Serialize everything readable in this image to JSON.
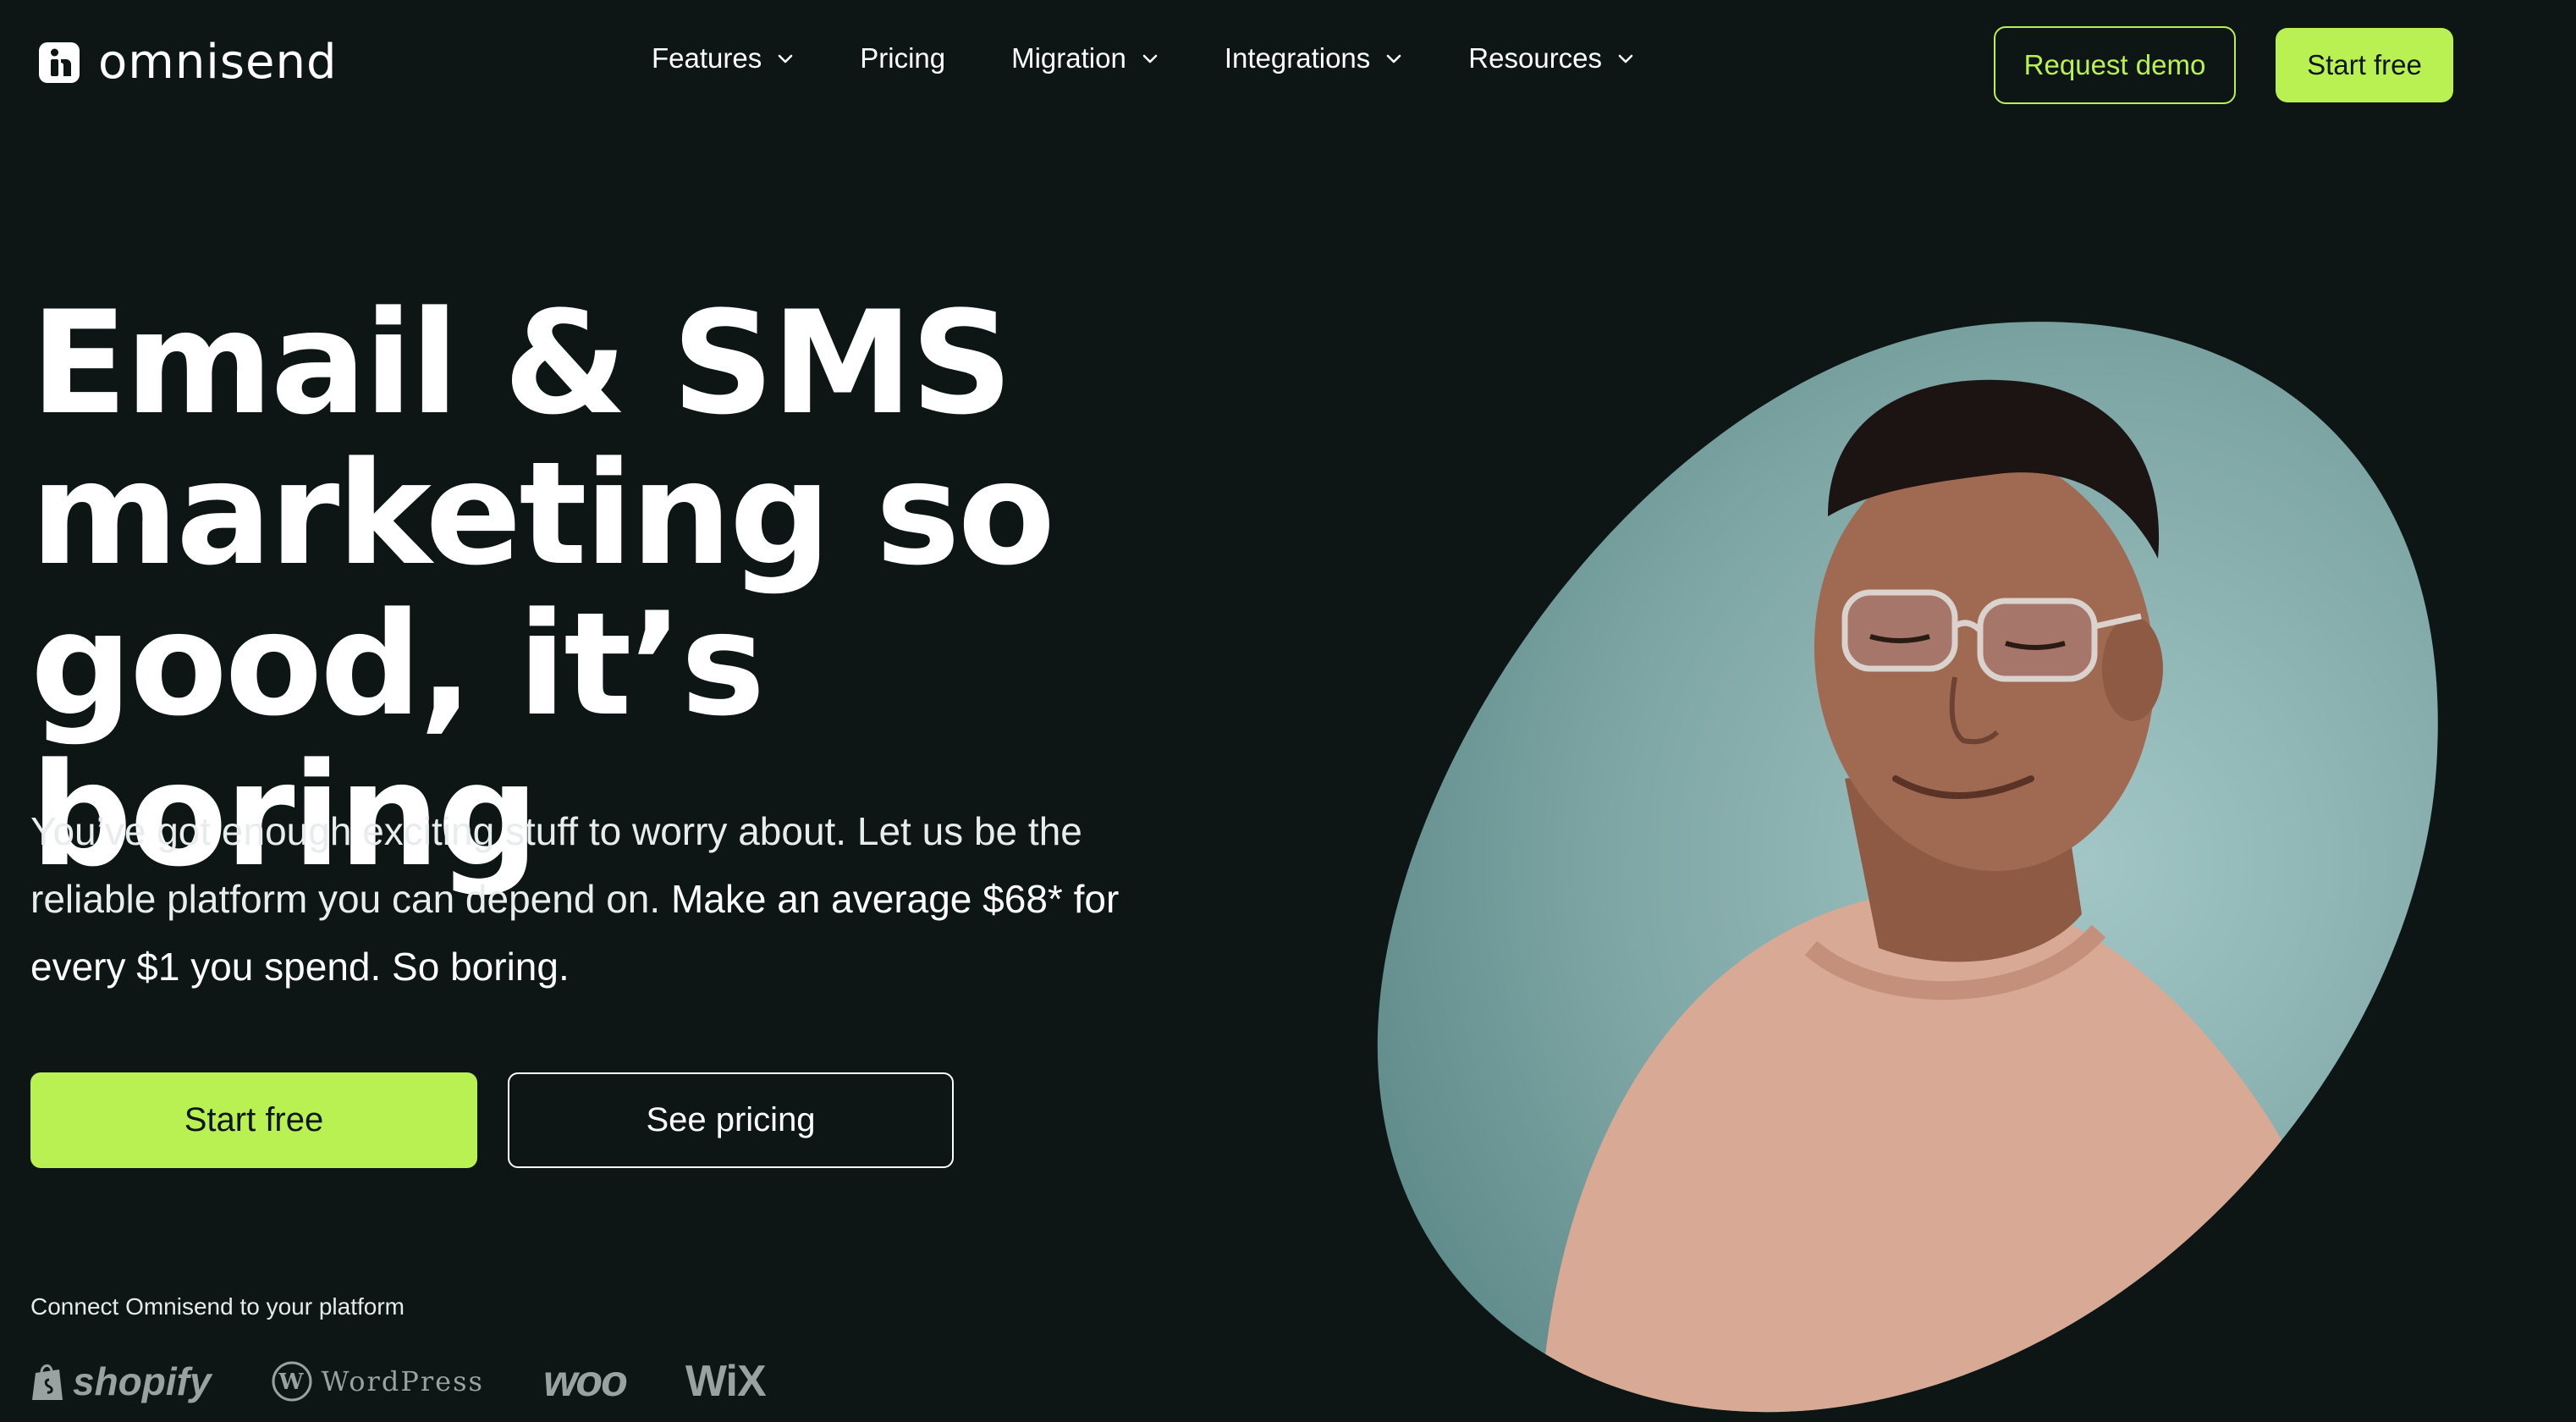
{
  "brand": {
    "name": "omnisend",
    "accent": "#b9f152",
    "background": "#0d1615"
  },
  "nav": {
    "items": [
      {
        "label": "Features",
        "has_dropdown": true
      },
      {
        "label": "Pricing",
        "has_dropdown": false
      },
      {
        "label": "Migration",
        "has_dropdown": true
      },
      {
        "label": "Integrations",
        "has_dropdown": true
      },
      {
        "label": "Resources",
        "has_dropdown": true
      }
    ],
    "request_demo": "Request demo",
    "start_free": "Start free"
  },
  "hero": {
    "title_lines": [
      "Email & SMS",
      "marketing so",
      "good, it’s boring"
    ],
    "subtitle_plain": "You’ve got enough exciting stuff to worry about. Let us be the reliable platform you can depend on.",
    "subtitle_strong": "Make an average $68* for every $1 you spend. So boring.",
    "cta_primary": "Start free",
    "cta_secondary": "See pricing"
  },
  "platforms": {
    "label": "Connect Omnisend to your platform",
    "logos": [
      {
        "name": "shopify",
        "icon": "shopify-bag-icon"
      },
      {
        "name": "WordPress",
        "icon": "wordpress-icon"
      },
      {
        "name": "woo",
        "icon": ""
      },
      {
        "name": "WiX",
        "icon": ""
      }
    ]
  },
  "portrait": {
    "icon": "smiling-man-portrait",
    "background": "#7fa7a6"
  }
}
